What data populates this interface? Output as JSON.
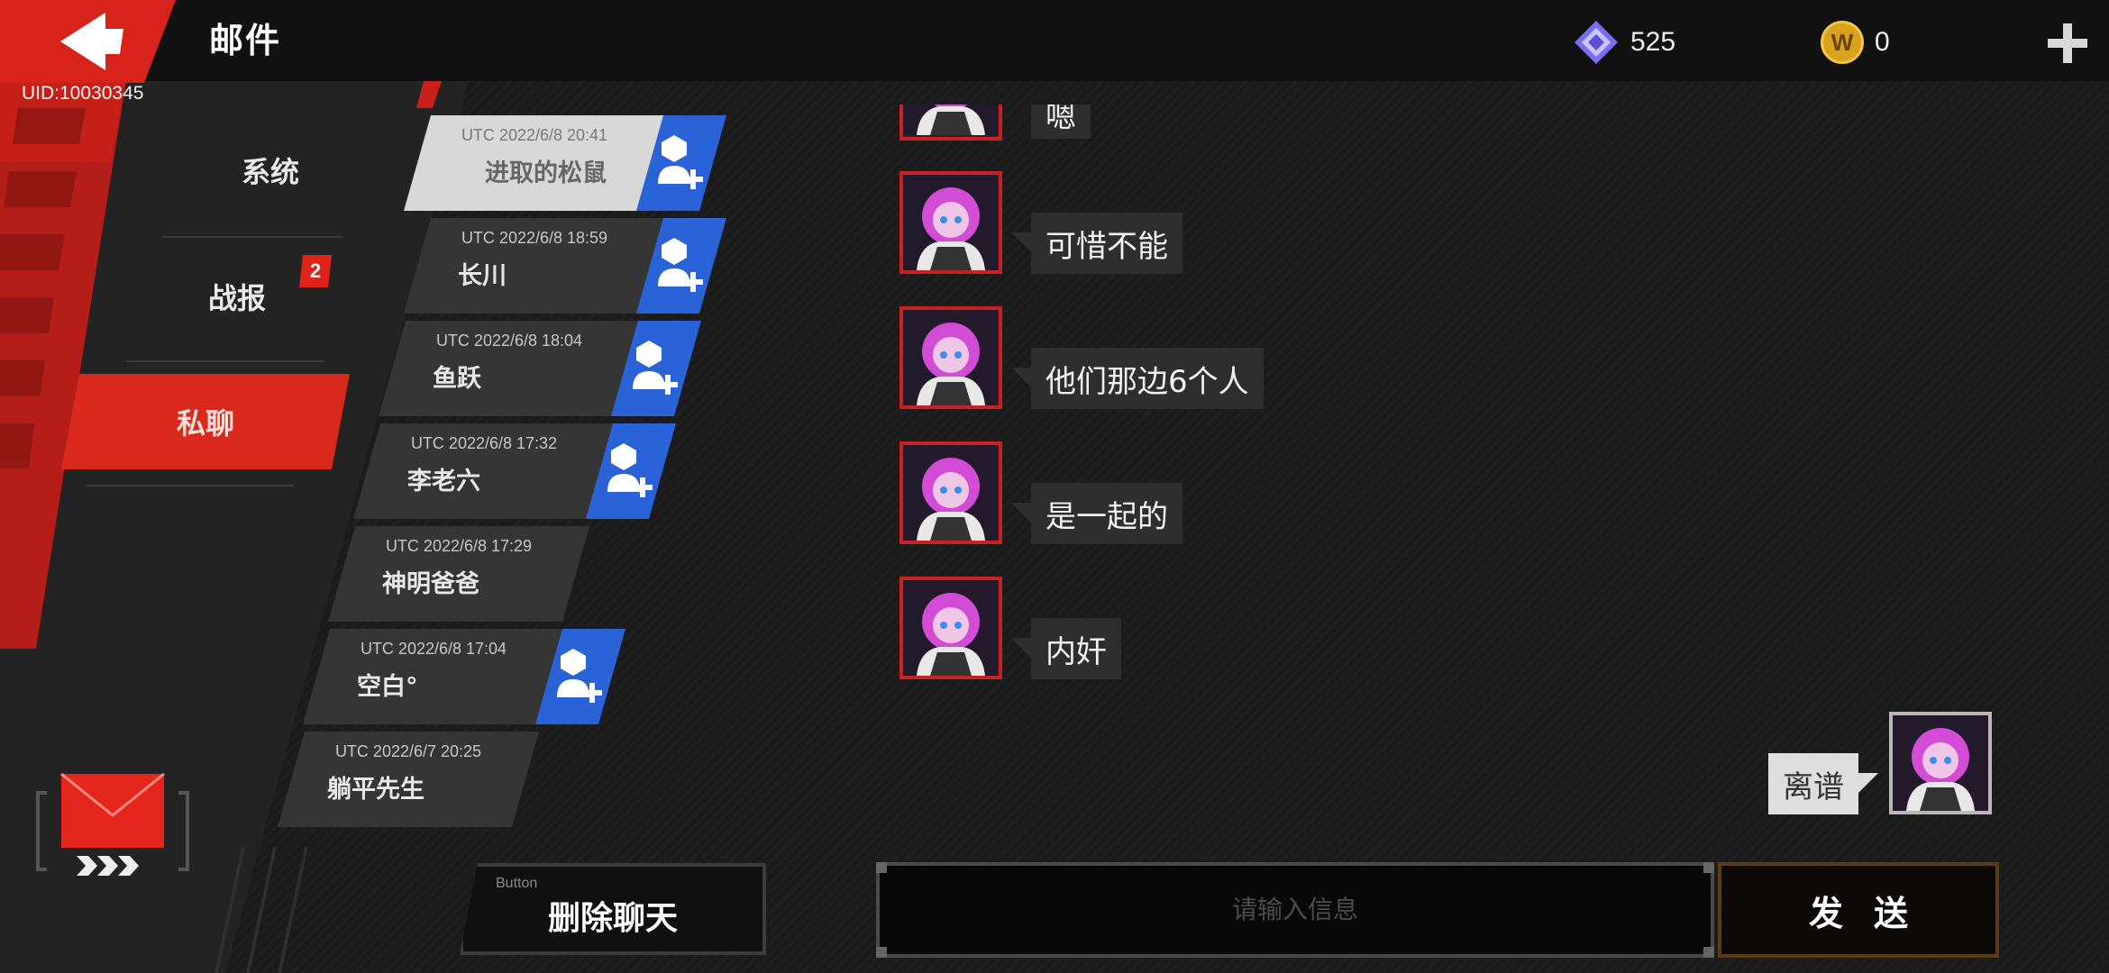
{
  "header": {
    "title": "邮件",
    "uid": "UID:10030345",
    "gems": "525",
    "coins": "0",
    "coin_letter": "W"
  },
  "categories": [
    {
      "label": "系统",
      "active": false
    },
    {
      "label": "战报",
      "active": false,
      "badge": "2"
    },
    {
      "label": "私聊",
      "active": true
    }
  ],
  "conversations": [
    {
      "time": "UTC 2022/6/8 20:41",
      "name": "进取的松鼠",
      "active": true,
      "can_add": true
    },
    {
      "time": "UTC 2022/6/8 18:59",
      "name": "长川",
      "active": false,
      "can_add": true
    },
    {
      "time": "UTC 2022/6/8 18:04",
      "name": "鱼跃",
      "active": false,
      "can_add": true
    },
    {
      "time": "UTC 2022/6/8 17:32",
      "name": "李老六",
      "active": false,
      "can_add": true
    },
    {
      "time": "UTC 2022/6/8 17:29",
      "name": "神明爸爸",
      "active": false,
      "can_add": false
    },
    {
      "time": "UTC 2022/6/8 17:04",
      "name": "空白°",
      "active": false,
      "can_add": true
    },
    {
      "time": "UTC 2022/6/7 20:25",
      "name": "躺平先生",
      "active": false,
      "can_add": false
    }
  ],
  "messages": [
    {
      "from": "other",
      "text": "嗯"
    },
    {
      "from": "other",
      "text": "可惜不能"
    },
    {
      "from": "other",
      "text": "他们那边6个人"
    },
    {
      "from": "other",
      "text": "是一起的"
    },
    {
      "from": "other",
      "text": "内奸"
    },
    {
      "from": "me",
      "text": "离谱"
    }
  ],
  "controls": {
    "delete_caption": "Button",
    "delete_label": "删除聊天",
    "input_placeholder": "请输入信息",
    "send_label": "发送"
  },
  "colors": {
    "accent_red": "#d9281c",
    "add_friend_blue": "#2a63d8",
    "gem_purple": "#8b7cf6",
    "coin_gold": "#d9a21b"
  },
  "icons": [
    "back-arrow-icon",
    "gem-icon",
    "coin-icon",
    "plus-icon",
    "add-friend-icon",
    "mail-icon"
  ]
}
